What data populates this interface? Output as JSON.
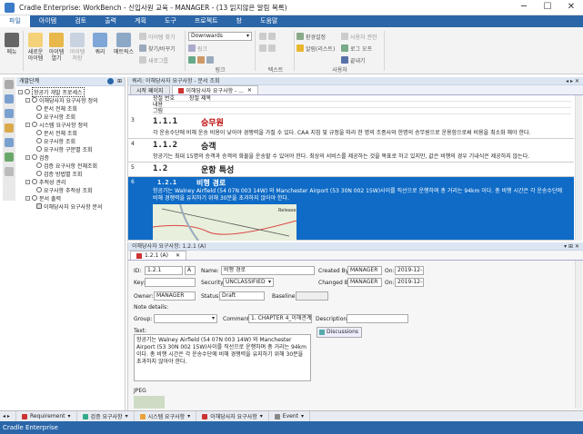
{
  "window": {
    "title": "Cradle Enterprise: WorkBench - 신입사원 교육 - MANAGER - (13 읽지않은 알림 목록)",
    "min": "─",
    "max": "☐",
    "close": "✕"
  },
  "menu": [
    {
      "label": "파일"
    },
    {
      "label": "아이템"
    },
    {
      "label": "검토"
    },
    {
      "label": "출력"
    },
    {
      "label": "계획"
    },
    {
      "label": "도구"
    },
    {
      "label": "프로젝트"
    },
    {
      "label": "창"
    },
    {
      "label": "도움말"
    }
  ],
  "ribbon": {
    "menu": "메뉴",
    "new_item": "새로운 아이템",
    "open_item": "아이템 열기",
    "save_item": "아이템 저장",
    "query": "쿼리",
    "matrix": "매트릭스",
    "item_find": "아이템 찾기",
    "find_replace": "찾기/바꾸기",
    "new_group": "새로그룹",
    "link_dir": "Downwards",
    "link": "링크",
    "group_label_link": "링크",
    "group_label_text": "텍스트",
    "env_settings": "환경설정",
    "alarm": "알림(리스트)",
    "user_mgmt": "사용자 권한",
    "logoff": "로그 오프",
    "exit": "끝내기",
    "group_label_user": "사용자"
  },
  "tree": {
    "header": "개발단계",
    "nodes": [
      {
        "label": "항공기 개발 프로세스"
      },
      {
        "label": "이해당사자 요구사항 정의"
      },
      {
        "label": "문서 전체 조회"
      },
      {
        "label": "요구사항 조회"
      },
      {
        "label": "시스템 요구사항 정의"
      },
      {
        "label": "문서 전체 조회"
      },
      {
        "label": "요구사항 조회"
      },
      {
        "label": "요구사항 구문별 조회"
      },
      {
        "label": "검증"
      },
      {
        "label": "검증 요구사항 전체조회"
      },
      {
        "label": "검증 방법별 조회"
      },
      {
        "label": "추적성 관리"
      },
      {
        "label": "요구사항 추적성 조회"
      },
      {
        "label": "문서 출력"
      },
      {
        "label": "이해당사자 요구사항 문서"
      }
    ]
  },
  "main": {
    "panel_title": "쿼리: 이해당사자 요구사항 - 문서 조회",
    "tabs": [
      {
        "label": "시작 페이지"
      },
      {
        "label": "이해당사자 요구사항 - ..."
      }
    ],
    "columns": {
      "c1": "장절 번호",
      "c2": "장절 제목",
      "c3": "내용",
      "c4": "그림"
    },
    "rows": [
      {
        "num": "3",
        "id": "1.1.1",
        "title": "승무원",
        "body": "각 운송수단에 비해 운송 비용이 낮아야 경쟁력을 가질 수 있다. CAA 지침 및 규정을 따라 한 명의 조종사와 한명의 승무원으로 운용함으로써 비용을 최소화 해야 한다."
      },
      {
        "num": "4",
        "id": "1.1.2",
        "title": "승객",
        "body": "항공기는 최대 15명의 승객과 승객의 화물을 운송할 수 있어야 한다. 최상의 서비스를 제공하는 것을 목표로 하고 있지만, 값은 비행의 경우 기내식은 제공하지 않는다."
      },
      {
        "num": "5",
        "id": "1.2",
        "title": "운항 특성",
        "body": ""
      },
      {
        "num": "6",
        "id": "1.2.1",
        "title": "비행 경로",
        "body": "항공기는 Walney Airfield (54 07N 003 14W) 와 Manchester Airport (53 30N 002 15W)사이를 직선으로 운행하며 총 거리는 94km 이다. 총 비행 시간은 각 운송수단에 비해 경쟁력을 유지하기 위해 30분을 초과하지 않아야 한다.",
        "map_label": "Release"
      }
    ]
  },
  "detail": {
    "panel_title": "이해당사자 요구사항: 1.2.1 (A)",
    "tab": "1.2.1 (A)",
    "id_label": "ID:",
    "id_value": "1.2.1",
    "id_ver": "A",
    "name_label": "Name:",
    "name_value": "비행 경로",
    "created_label": "Created By:",
    "created_value": "MANAGER",
    "on_label1": "On:",
    "on_value1": "2019-12-..",
    "key_label": "Key:",
    "security_label": "Security:",
    "security_value": "UNCLASSIFIED",
    "changed_label": "Changed By:",
    "changed_value": "MANAGER",
    "on_label2": "On:",
    "on_value2": "2019-12-..",
    "owner_label": "Owner:",
    "owner_value": "MANAGER",
    "status_label": "Status:",
    "status_value": "Draft",
    "baseline_label": "Baseline:",
    "note_label": "Note details:",
    "group_label": "Group:",
    "comment_label": "Comment:",
    "comment_value": "1. CHAPTER 4_이해관계",
    "desc_label": "Description:",
    "discussions": "Discussions",
    "text_label": "Text:",
    "text_value": "항공기는 Walney Airfield (54 07N 003 14W) 와 Manchester Airport (53 30N 002 15W)사이를 직선으로 운행하며 총 거리는 94km 이다. 총 비행 시간은 각 운송수단에 비해 경쟁력을 유지하기 위해 30분을 초과하지 않아야 한다.",
    "jpeg_label": "JPEG"
  },
  "status_tabs": [
    {
      "label": "Requirement"
    },
    {
      "label": "검증 요구사항"
    },
    {
      "label": "시스템 요구사항"
    },
    {
      "label": "이해당사자 요구사항"
    },
    {
      "label": "Event"
    }
  ],
  "statusbar": "Cradle Enterprise",
  "colors": {
    "accent": "#2b66a8",
    "selected_row": "#0f6bc6",
    "heading_red": "#b00"
  }
}
